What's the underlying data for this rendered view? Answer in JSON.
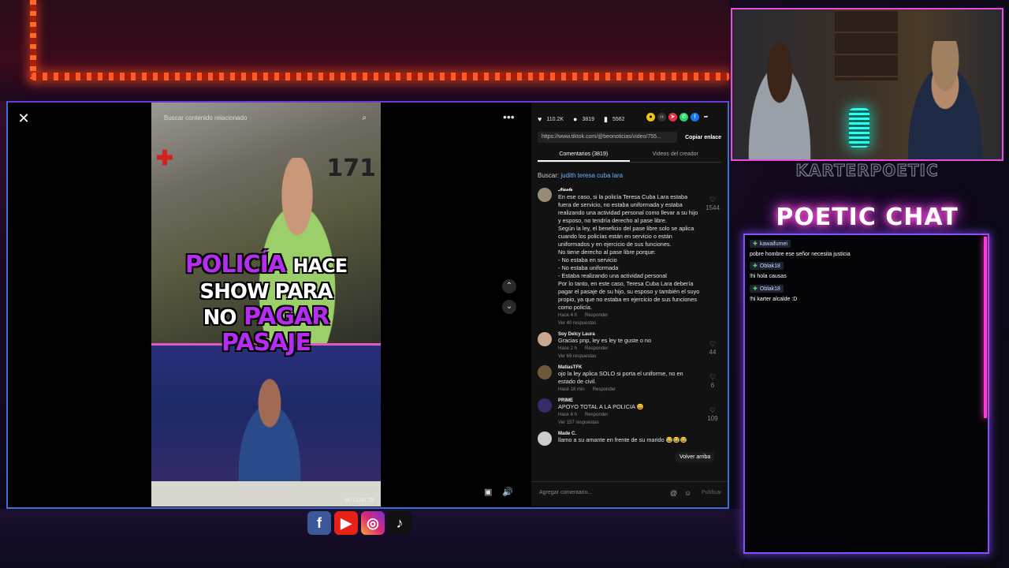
{
  "video": {
    "search_placeholder": "Buscar contenido relacionado",
    "bus_number": "171",
    "caption_line1_purple": "POLICÍA",
    "caption_line1_white": "HACE",
    "caption_line2_white": "SHOW PARA",
    "caption_line3_white": "NO",
    "caption_line3_purple": "PAGAR",
    "caption_line4_purple": "PASAJE",
    "time": "00:01/01:25"
  },
  "stats": {
    "likes": "110.2K",
    "comments": "3819",
    "saves": "5562"
  },
  "share_icons": [
    "coin-icon",
    "embed-icon",
    "send-icon",
    "whatsapp-icon",
    "facebook-icon",
    "share-arrow-icon"
  ],
  "link": {
    "url": "https://www.tiktok.com/@beonoticias/video/755...",
    "copy_label": "Copiar enlace"
  },
  "tabs": {
    "comments": "Comentarios (3819)",
    "creator": "Videos del creador"
  },
  "search": {
    "label": "Buscar:",
    "query": "judith teresa cuba lara"
  },
  "comments": [
    {
      "user": "𝓝𝓲𝓬𝓸𝓵𝓮",
      "text": "En ese caso, si la policía Teresa Cuba Lara estaba fuera de servicio, no estaba uniformada y estaba realizando una actividad personal como llevar a su hijo y esposo, no tendría derecho al pase libre.\nSegún la ley, el beneficio del pase libre solo se aplica cuando los policías están en servicio o están uniformados y en ejercicio de sus funciones.\nNo tiene derecho al pase libre porque:\n- No estaba en servicio\n- No estaba uniformada\n- Estaba realizando una actividad personal\nPor lo tanto, en este caso, Teresa Cuba Lara debería pagar el pasaje de su hijo, su esposo y también el suyo propio, ya que no estaba en ejercicio de sus funciones como policía.",
      "time": "Hace 4 h",
      "reply": "Responder",
      "replies": "Ver 40 respuestas",
      "likes": "1544"
    },
    {
      "user": "Soy Delcy Laura",
      "text": "Gracias pnp, ley es ley te guste o no",
      "time": "Hace 2 h",
      "reply": "Responder",
      "replies": "Ver 69 respuestas",
      "likes": "44"
    },
    {
      "user": "MatiasTFK",
      "text": "ojo la ley aplica SOLO si porta el uniforme, no en estado de civil.",
      "time": "Hace 18 min",
      "reply": "Responder",
      "replies": "",
      "likes": "6"
    },
    {
      "user": "PRIME",
      "text": "APOYO TOTAL A LA POLICIA 😄",
      "time": "Hace 6 h",
      "reply": "Responder",
      "replies": "Ver 157 respuestas",
      "likes": "109"
    },
    {
      "user": "Made C.",
      "text": "llamo a su amante en frente de su marido 😂😂😂",
      "time": "",
      "reply": "",
      "replies": "",
      "likes": ""
    }
  ],
  "back_to_top": "Volver arriba",
  "comment_bar": {
    "placeholder": "Agregar comentario...",
    "publish": "Publicar"
  },
  "stream": {
    "channel_name": "KARTERPOETIC",
    "chat_title": "POETIC CHAT",
    "chat": [
      {
        "user": "kawaifumei",
        "text": "pobre hombre ese señor necesita justicia"
      },
      {
        "user": "Oblak18",
        "text": "!hi hola causas"
      },
      {
        "user": "Oblak18",
        "text": "!hi karter alcalde :D"
      }
    ]
  },
  "colors": {
    "caption_purple": "#b62cf2",
    "chat_glow": "#ff4fd8",
    "tiktok_link": "#6fb1ff"
  }
}
